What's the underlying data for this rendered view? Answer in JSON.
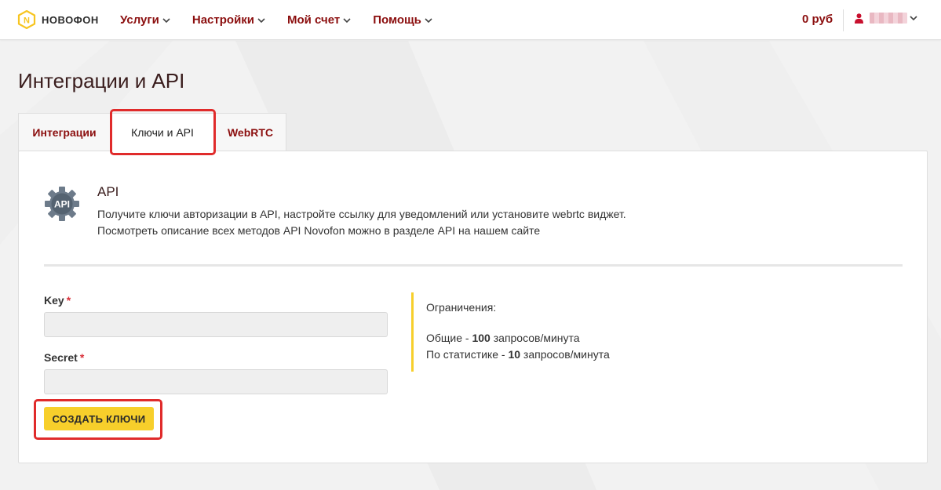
{
  "header": {
    "logo_text": "НОВОФОН",
    "nav": [
      {
        "label": "Услуги"
      },
      {
        "label": "Настройки"
      },
      {
        "label": "Мой счет"
      },
      {
        "label": "Помощь"
      }
    ],
    "balance": "0 руб"
  },
  "page": {
    "title": "Интеграции и API"
  },
  "tabs": [
    {
      "label": "Интеграции"
    },
    {
      "label": "Ключи и API",
      "active": true
    },
    {
      "label": "WebRTC"
    }
  ],
  "api_section": {
    "icon_text": "API",
    "title": "API",
    "desc_line1": "Получите ключи авторизации в API, настройте ссылку для уведомлений или установите webrtc виджет.",
    "desc_line2": "Посмотреть описание всех методов API Novofon можно в разделе API на нашем сайте"
  },
  "form": {
    "key_label": "Key",
    "key_value": "",
    "secret_label": "Secret",
    "secret_value": "",
    "required_mark": "*",
    "create_button": "СОЗДАТЬ КЛЮЧИ"
  },
  "limits": {
    "title": "Ограничения:",
    "general_prefix": "Общие - ",
    "general_value": "100",
    "general_suffix": " запросов/минута",
    "stats_prefix": "По статистике - ",
    "stats_value": "10",
    "stats_suffix": " запросов/минута"
  },
  "colors": {
    "brand_yellow": "#f7cf2b",
    "nav_red": "#8b0e0e",
    "highlight_red": "#e02b2b",
    "required_red": "#d9303a"
  },
  "icons": [
    "novofon-logo-icon",
    "chevron-down-icon",
    "user-icon",
    "api-gear-icon"
  ]
}
